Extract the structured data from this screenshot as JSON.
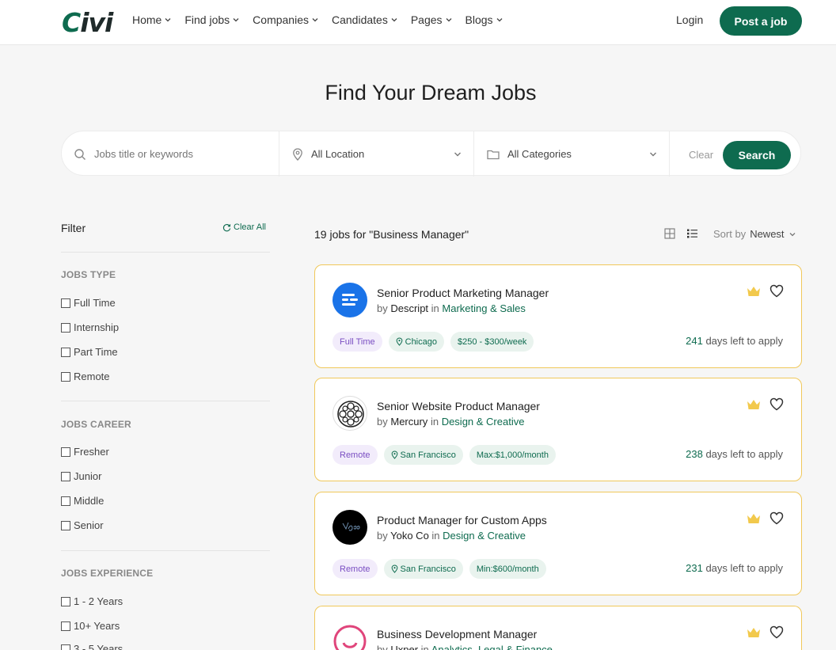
{
  "header": {
    "logo": "Civi",
    "nav": [
      "Home",
      "Find jobs",
      "Companies",
      "Candidates",
      "Pages",
      "Blogs"
    ],
    "login": "Login",
    "post_job": "Post a job"
  },
  "hero": {
    "title": "Find Your Dream Jobs"
  },
  "search": {
    "keyword_placeholder": "Jobs title or keywords",
    "location": "All Location",
    "category": "All Categories",
    "clear": "Clear",
    "button": "Search"
  },
  "filter": {
    "title": "Filter",
    "clear_all": "Clear All",
    "sections": [
      {
        "title": "JOBS TYPE",
        "options": [
          "Full Time",
          "Internship",
          "Part Time",
          "Remote"
        ]
      },
      {
        "title": "JOBS CAREER",
        "options": [
          "Fresher",
          "Junior",
          "Middle",
          "Senior"
        ]
      },
      {
        "title": "JOBS EXPERIENCE",
        "options": [
          "1 - 2 Years",
          "10+ Years",
          "3 - 5 Years"
        ]
      }
    ]
  },
  "results": {
    "count_text": "19 jobs for \"Business Manager\"",
    "sort_label": "Sort by",
    "sort_value": "Newest"
  },
  "jobs": [
    {
      "title": "Senior Product Marketing Manager",
      "by": "by",
      "company": "Descript",
      "in": "in",
      "category": "Marketing & Sales",
      "type": "Full Time",
      "location": "Chicago",
      "salary": "$250 - $300/week",
      "days": "241",
      "days_suffix": "days left to apply"
    },
    {
      "title": "Senior Website Product Manager",
      "by": "by",
      "company": "Mercury",
      "in": "in",
      "category": "Design & Creative",
      "type": "Remote",
      "location": "San Francisco",
      "salary": "Max:$1,000/month",
      "days": "238",
      "days_suffix": "days left to apply"
    },
    {
      "title": "Product Manager for Custom Apps",
      "by": "by",
      "company": "Yoko Co",
      "in": "in",
      "category": "Design & Creative",
      "type": "Remote",
      "location": "San Francisco",
      "salary": "Min:$600/month",
      "days": "231",
      "days_suffix": "days left to apply"
    },
    {
      "title": "Business Development Manager",
      "by": "by",
      "company": "Uxper",
      "in": "in",
      "category": "Analytics, Legal & Finance"
    }
  ],
  "colors": {
    "brand": "#0e6b4f",
    "card_border": "#f0c85a",
    "crown": "#f2c94c"
  }
}
